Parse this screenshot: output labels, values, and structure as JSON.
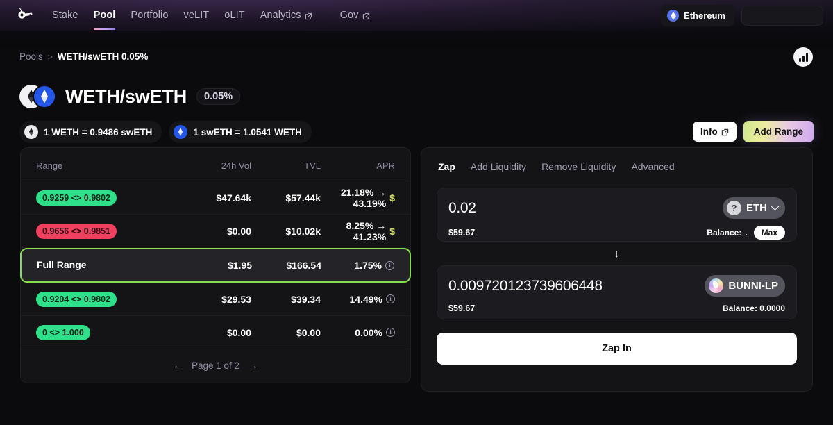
{
  "header": {
    "logo_icon": "key-logo-icon",
    "nav": [
      {
        "label": "Stake",
        "external": false,
        "active": false
      },
      {
        "label": "Pool",
        "external": false,
        "active": true
      },
      {
        "label": "Portfolio",
        "external": false,
        "active": false
      },
      {
        "label": "veLIT",
        "external": false,
        "active": false
      },
      {
        "label": "oLIT",
        "external": false,
        "active": false
      },
      {
        "label": "Analytics",
        "external": true,
        "active": false
      },
      {
        "label": "Gov",
        "external": true,
        "active": false
      }
    ],
    "chain": {
      "label": "Ethereum",
      "icon": "ethereum-icon"
    },
    "connect_wallet": {
      "label": ""
    }
  },
  "breadcrumb": {
    "parent": "Pools",
    "separator": ">",
    "current": "WETH/swETH 0.05%"
  },
  "corner_logo_icon": "bunni-bars-icon",
  "pool": {
    "name": "WETH/swETH",
    "fee": "0.05%",
    "token0_icon": "weth-icon",
    "token1_icon": "sweth-icon",
    "rates": [
      {
        "icon": "weth-icon",
        "text": "1 WETH = 0.9486 swETH"
      },
      {
        "icon": "sweth-icon",
        "text": "1 swETH = 1.0541 WETH"
      }
    ],
    "info_button": "Info",
    "add_range_button": "Add Range"
  },
  "table": {
    "columns": [
      "Range",
      "24h Vol",
      "TVL",
      "APR"
    ],
    "rows": [
      {
        "range": "0.9259 <> 0.9802",
        "range_type": "green",
        "vol": "$47.64k",
        "tvl": "$57.44k",
        "apr": "21.18% → 43.19%",
        "apr_icon": "dollar-icon",
        "selected": false
      },
      {
        "range": "0.9656 <> 0.9851",
        "range_type": "red",
        "vol": "$0.00",
        "tvl": "$10.02k",
        "apr": "8.25% → 41.23%",
        "apr_icon": "dollar-icon",
        "selected": false
      },
      {
        "range": "Full Range",
        "range_type": "plain",
        "vol": "$1.95",
        "tvl": "$166.54",
        "apr": "1.75%",
        "apr_icon": "info-icon",
        "selected": true
      },
      {
        "range": "0.9204 <> 0.9802",
        "range_type": "green",
        "vol": "$29.53",
        "tvl": "$39.34",
        "apr": "14.49%",
        "apr_icon": "info-icon",
        "selected": false
      },
      {
        "range": "0 <> 1.000",
        "range_type": "green",
        "vol": "$0.00",
        "tvl": "$0.00",
        "apr": "0.00%",
        "apr_icon": "info-icon",
        "selected": false
      }
    ],
    "pagination": {
      "prev_icon": "arrow-left-icon",
      "label": "Page 1 of 2",
      "next_icon": "arrow-right-icon"
    }
  },
  "zap": {
    "tabs": [
      {
        "label": "Zap",
        "active": true
      },
      {
        "label": "Add Liquidity",
        "active": false
      },
      {
        "label": "Remove Liquidity",
        "active": false
      },
      {
        "label": "Advanced",
        "active": false
      }
    ],
    "input_from": {
      "amount": "0.02",
      "usd": "$59.67",
      "token": "ETH",
      "token_icon": "question-mark-icon",
      "balance_label": "Balance:",
      "balance_value": ".",
      "max_label": "Max"
    },
    "swap_arrow_icon": "arrow-down-icon",
    "input_to": {
      "amount": "0.009720123739606448",
      "usd": "$59.67",
      "token": "BUNNI-LP",
      "token_icon": "bunni-lp-icon",
      "balance_label": "Balance: 0.0000"
    },
    "submit_button": "Zap In"
  },
  "colors": {
    "accent_green": "#2fe08a",
    "accent_red": "#ef4060",
    "selected_border": "#86e04e",
    "dollar_yellow": "#d9e26a",
    "panel_bg": "#141416",
    "page_bg": "#0b0b0d"
  }
}
